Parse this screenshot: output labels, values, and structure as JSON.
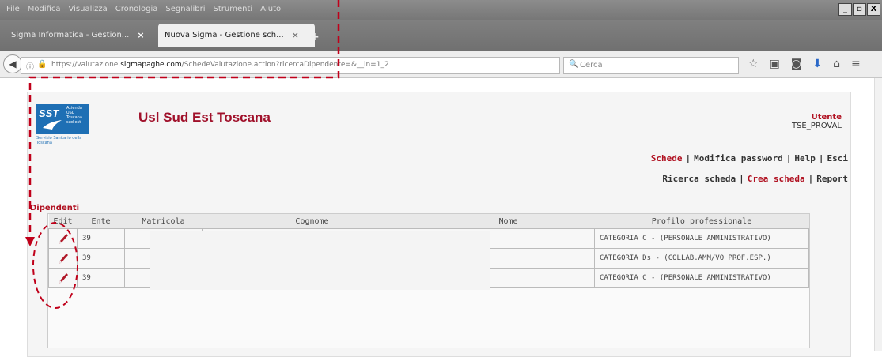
{
  "menubar": {
    "items": [
      "File",
      "Modifica",
      "Visualizza",
      "Cronologia",
      "Segnalibri",
      "Strumenti",
      "Aiuto"
    ],
    "window_controls": [
      "_",
      "\u0018",
      "X"
    ]
  },
  "tabs": [
    {
      "label": "Sigma Informatica - Gestion...",
      "close": "×"
    },
    {
      "label": "Nuova Sigma - Gestione sch...",
      "close": "×"
    }
  ],
  "new_tab": "+",
  "navbar": {
    "url_prefix": "https://valutazione.",
    "url_domain": "sigmapaghe.com",
    "url_suffix": "/SchedeValutazione.action?ricercaDipendente=&__in=1_2",
    "search_placeholder": "Cerca"
  },
  "site": {
    "title": "Usl Sud Est Toscana",
    "logo": {
      "text": "SST",
      "small": "Azienda USL Toscana sud est",
      "bottom": "Servizio Sanitario della Toscana"
    }
  },
  "user": {
    "label": "Utente",
    "name": "TSE_PROVAL"
  },
  "nav1": [
    {
      "label": "Schede",
      "active": true
    },
    {
      "label": "Modifica password",
      "active": false
    },
    {
      "label": "Help",
      "active": false
    },
    {
      "label": "Esci",
      "active": false
    }
  ],
  "nav2": [
    {
      "label": "Ricerca scheda",
      "active": false
    },
    {
      "label": "Crea scheda",
      "active": true
    },
    {
      "label": "Report",
      "active": false
    }
  ],
  "section_title": "Dipendenti",
  "table": {
    "headers": [
      "Edit",
      "Ente",
      "Matricola",
      "Cognome",
      "Nome",
      "Profilo professionale"
    ],
    "rows": [
      {
        "ente": "39",
        "matricola": "",
        "cognome": "",
        "nome": "",
        "profilo": "CATEGORIA C - (PERSONALE AMMINISTRATIVO)"
      },
      {
        "ente": "39",
        "matricola": "",
        "cognome": "",
        "nome": "",
        "profilo": "CATEGORIA Ds - (COLLAB.AMM/VO PROF.ESP.)"
      },
      {
        "ente": "39",
        "matricola": "",
        "cognome": "",
        "nome": "",
        "profilo": "CATEGORIA C - (PERSONALE AMMINISTRATIVO)"
      }
    ]
  },
  "colors": {
    "accent": "#b01020",
    "annotation": "#c0001a",
    "logo_blue": "#1e6fb4"
  }
}
